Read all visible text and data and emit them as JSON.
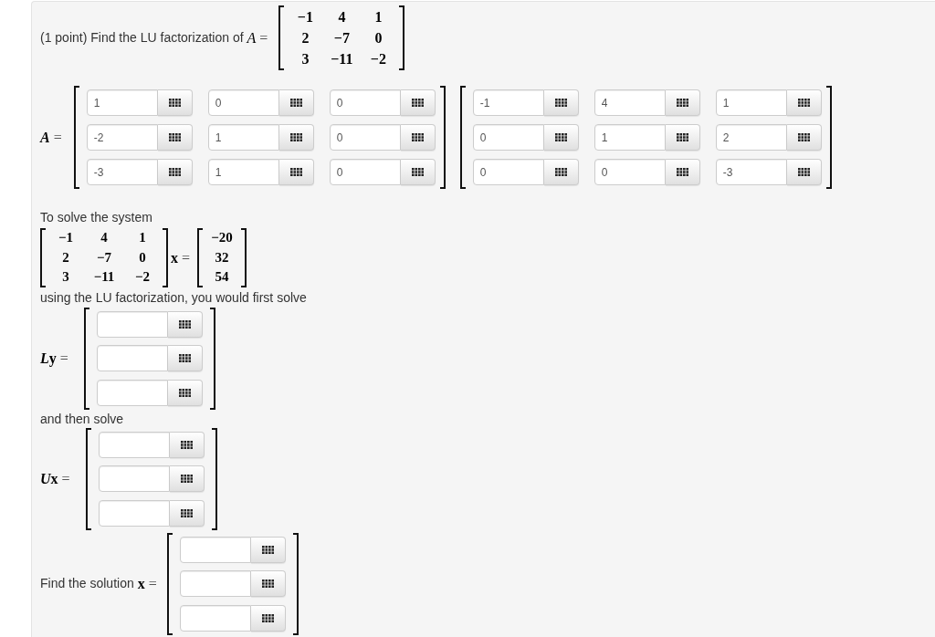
{
  "question": {
    "prompt": "(1 point) Find the LU factorization of",
    "label": [
      {
        "kind": "variable",
        "text": "A"
      },
      {
        "kind": "relation",
        "text": "="
      }
    ],
    "matrix": [
      [
        "−1",
        "4",
        "1"
      ],
      [
        "2",
        "−7",
        "0"
      ],
      [
        "3",
        "−11",
        "−2"
      ]
    ]
  },
  "factorization": {
    "label": [
      {
        "kind": "matrix",
        "text": "A"
      },
      {
        "kind": "relation",
        "text": "="
      }
    ],
    "factors": [
      {
        "rows": [
          [
            {
              "kind": "entry",
              "value": "1"
            },
            {
              "kind": "entry",
              "value": "0"
            },
            {
              "kind": "entry",
              "value": "0"
            }
          ],
          [
            {
              "kind": "entry",
              "value": "-2"
            },
            {
              "kind": "entry",
              "value": "1"
            },
            {
              "kind": "entry",
              "value": "0"
            }
          ],
          [
            {
              "kind": "entry",
              "value": "-3"
            },
            {
              "kind": "entry",
              "value": "1"
            },
            {
              "kind": "entry",
              "value": "0"
            }
          ]
        ]
      },
      {
        "rows": [
          [
            {
              "kind": "entry",
              "value": "-1"
            },
            {
              "kind": "entry",
              "value": "4"
            },
            {
              "kind": "entry",
              "value": "1"
            }
          ],
          [
            {
              "kind": "entry",
              "value": "0"
            },
            {
              "kind": "entry",
              "value": "1"
            },
            {
              "kind": "entry",
              "value": "2"
            }
          ],
          [
            {
              "kind": "entry",
              "value": "0"
            },
            {
              "kind": "entry",
              "value": "0"
            },
            {
              "kind": "entry",
              "value": "-3"
            }
          ]
        ]
      }
    ]
  },
  "system": {
    "intro": "To solve the system",
    "matrix": [
      [
        "−1",
        "4",
        "1"
      ],
      [
        "2",
        "−7",
        "0"
      ],
      [
        "3",
        "−11",
        "−2"
      ]
    ],
    "unknown": [
      {
        "kind": "vector",
        "text": "x"
      },
      {
        "kind": "relation",
        "text": "="
      }
    ],
    "rhs": [
      "−20",
      "32",
      "54"
    ],
    "outro": "using the LU factorization, you would first solve"
  },
  "forward_step": {
    "label": [
      {
        "kind": "matrix",
        "text": "L"
      },
      {
        "kind": "vector",
        "text": "y"
      },
      {
        "kind": "relation",
        "text": "="
      }
    ],
    "entries": [
      {
        "kind": "entry"
      },
      {
        "kind": "entry"
      },
      {
        "kind": "entry"
      }
    ]
  },
  "then_text": "and then solve",
  "back_step": {
    "label": [
      {
        "kind": "matrix",
        "text": "U"
      },
      {
        "kind": "vector",
        "text": "x"
      },
      {
        "kind": "relation",
        "text": "="
      }
    ],
    "entries": [
      {
        "kind": "entry"
      },
      {
        "kind": "entry"
      },
      {
        "kind": "entry"
      }
    ]
  },
  "solution": {
    "prompt": "Find the solution",
    "label": [
      {
        "kind": "vector",
        "text": "x"
      },
      {
        "kind": "relation",
        "text": "="
      }
    ],
    "entries": [
      {
        "kind": "entry"
      },
      {
        "kind": "entry"
      },
      {
        "kind": "entry"
      }
    ]
  }
}
